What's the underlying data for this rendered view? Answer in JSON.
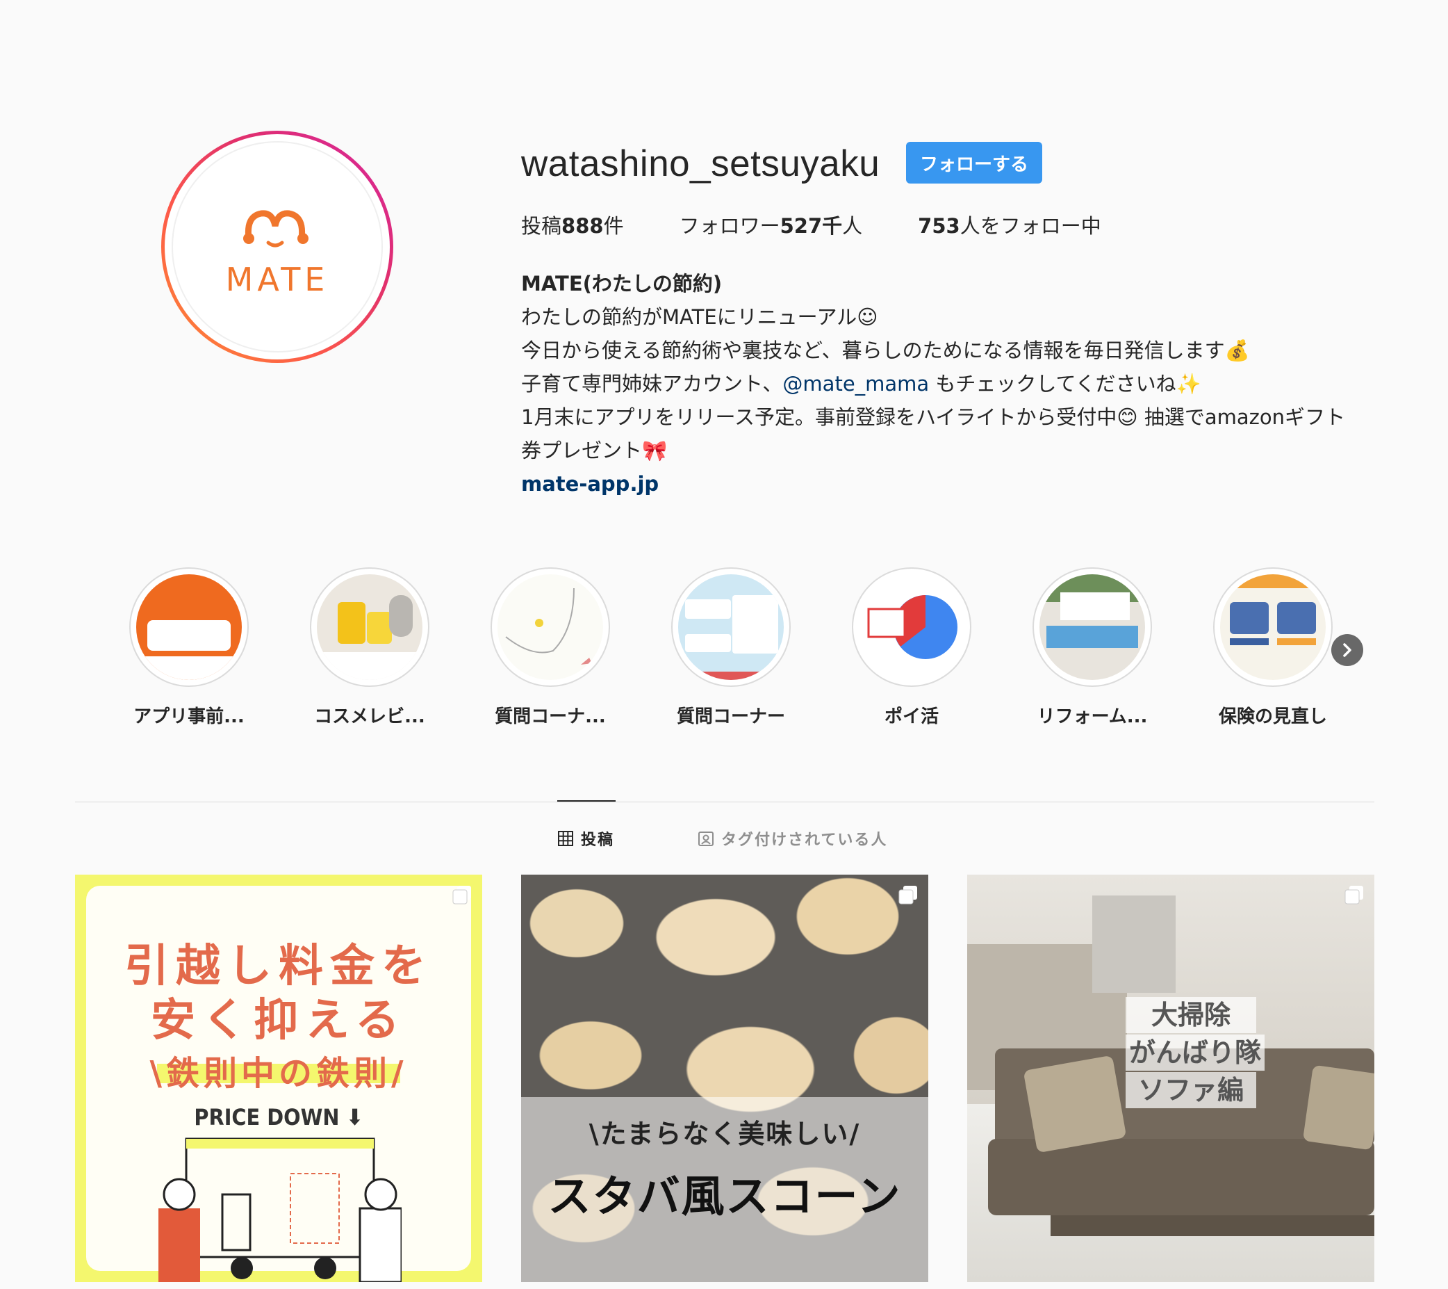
{
  "profile": {
    "username": "watashino_setsuyaku",
    "follow_label": "フォローする",
    "avatar_text": "MATE"
  },
  "stats": {
    "posts_prefix": "投稿",
    "posts_value": "888",
    "posts_suffix": "件",
    "followers_prefix": "フォロワー",
    "followers_value": "527千",
    "followers_suffix": "人",
    "following_value": "753",
    "following_suffix": "人をフォロー中"
  },
  "bio": {
    "name": "MATE(わたしの節約)",
    "line1": "わたしの節約がMATEにリニューアル☺",
    "line2": "今日から使える節約術や裏技など、暮らしのためになる情報を毎日発信します💰",
    "line3_before": "子育て専門姉妹アカウント、",
    "line3_mention": "@mate_mama",
    "line3_after": " もチェックしてくださいね✨",
    "line4": "1月末にアプリをリリース予定。事前登録をハイライトから受付中😊 抽選でamazonギフト",
    "line5": "券プレゼント🎀",
    "link": "mate-app.jp"
  },
  "highlights": [
    {
      "label": "アプリ事前..."
    },
    {
      "label": "コスメレビ..."
    },
    {
      "label": "質問コーナ..."
    },
    {
      "label": "質問コーナー"
    },
    {
      "label": "ポイ活"
    },
    {
      "label": "リフォーム..."
    },
    {
      "label": "保険の見直し"
    }
  ],
  "tabs": {
    "posts": "投稿",
    "tagged": "タグ付けされている人"
  },
  "posts": [
    {
      "line1": "引越し料金を",
      "line2": "安く抑える",
      "line3": "\\鉄則中の鉄則/",
      "price": "PRICE DOWN ⬇"
    },
    {
      "line1": "\\たまらなく美味しい/",
      "line2": "スタバ風スコーン"
    },
    {
      "line1": "大掃除",
      "line2": "がんばり隊",
      "line3": "ソファ編"
    }
  ],
  "colors": {
    "follow_button": "#3897f0",
    "link": "#003569",
    "accent_orange": "#f0762d"
  }
}
